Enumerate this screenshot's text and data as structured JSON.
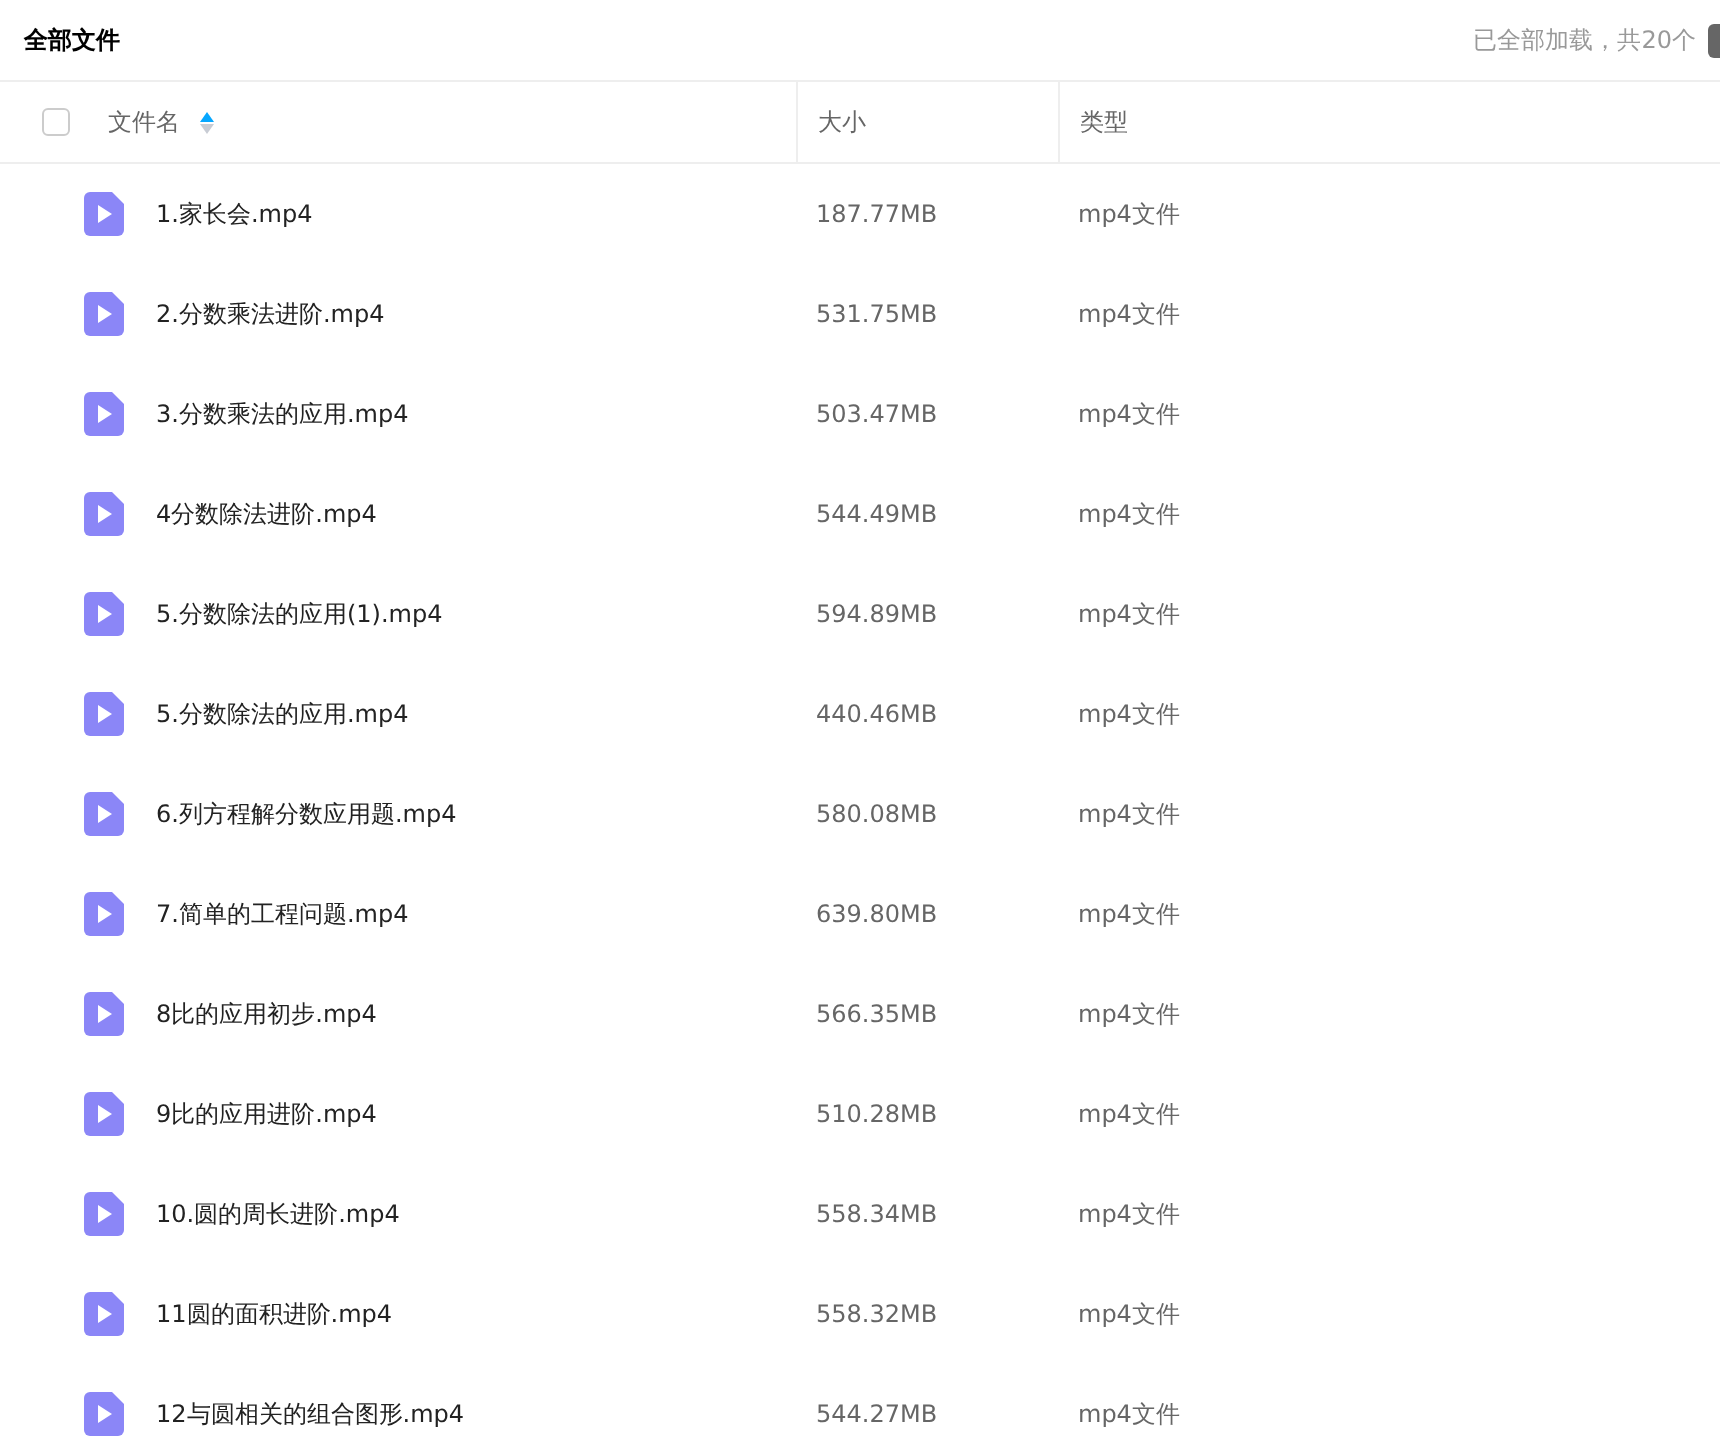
{
  "title": "全部文件",
  "status": "已全部加载，共20个",
  "columns": [
    {
      "label": "文件名",
      "sortable": true
    },
    {
      "label": "大小",
      "sortable": false
    },
    {
      "label": "类型",
      "sortable": false
    }
  ],
  "select_all": {
    "checked": false
  },
  "rows": [
    {
      "name": "1.家长会.mp4",
      "size": "187.77MB",
      "type": "mp4文件"
    },
    {
      "name": "2.分数乘法进阶.mp4",
      "size": "531.75MB",
      "type": "mp4文件"
    },
    {
      "name": "3.分数乘法的应用.mp4",
      "size": "503.47MB",
      "type": "mp4文件"
    },
    {
      "name": "4分数除法进阶.mp4",
      "size": "544.49MB",
      "type": "mp4文件"
    },
    {
      "name": "5.分数除法的应用(1).mp4",
      "size": "594.89MB",
      "type": "mp4文件"
    },
    {
      "name": "5.分数除法的应用.mp4",
      "size": "440.46MB",
      "type": "mp4文件"
    },
    {
      "name": "6.列方程解分数应用题.mp4",
      "size": "580.08MB",
      "type": "mp4文件"
    },
    {
      "name": "7.简单的工程问题.mp4",
      "size": "639.80MB",
      "type": "mp4文件"
    },
    {
      "name": "8比的应用初步.mp4",
      "size": "566.35MB",
      "type": "mp4文件"
    },
    {
      "name": "9比的应用进阶.mp4",
      "size": "510.28MB",
      "type": "mp4文件"
    },
    {
      "name": "10.圆的周长进阶.mp4",
      "size": "558.34MB",
      "type": "mp4文件"
    },
    {
      "name": "11圆的面积进阶.mp4",
      "size": "558.32MB",
      "type": "mp4文件"
    },
    {
      "name": "12与圆相关的组合图形.mp4",
      "size": "544.27MB",
      "type": "mp4文件"
    }
  ]
}
